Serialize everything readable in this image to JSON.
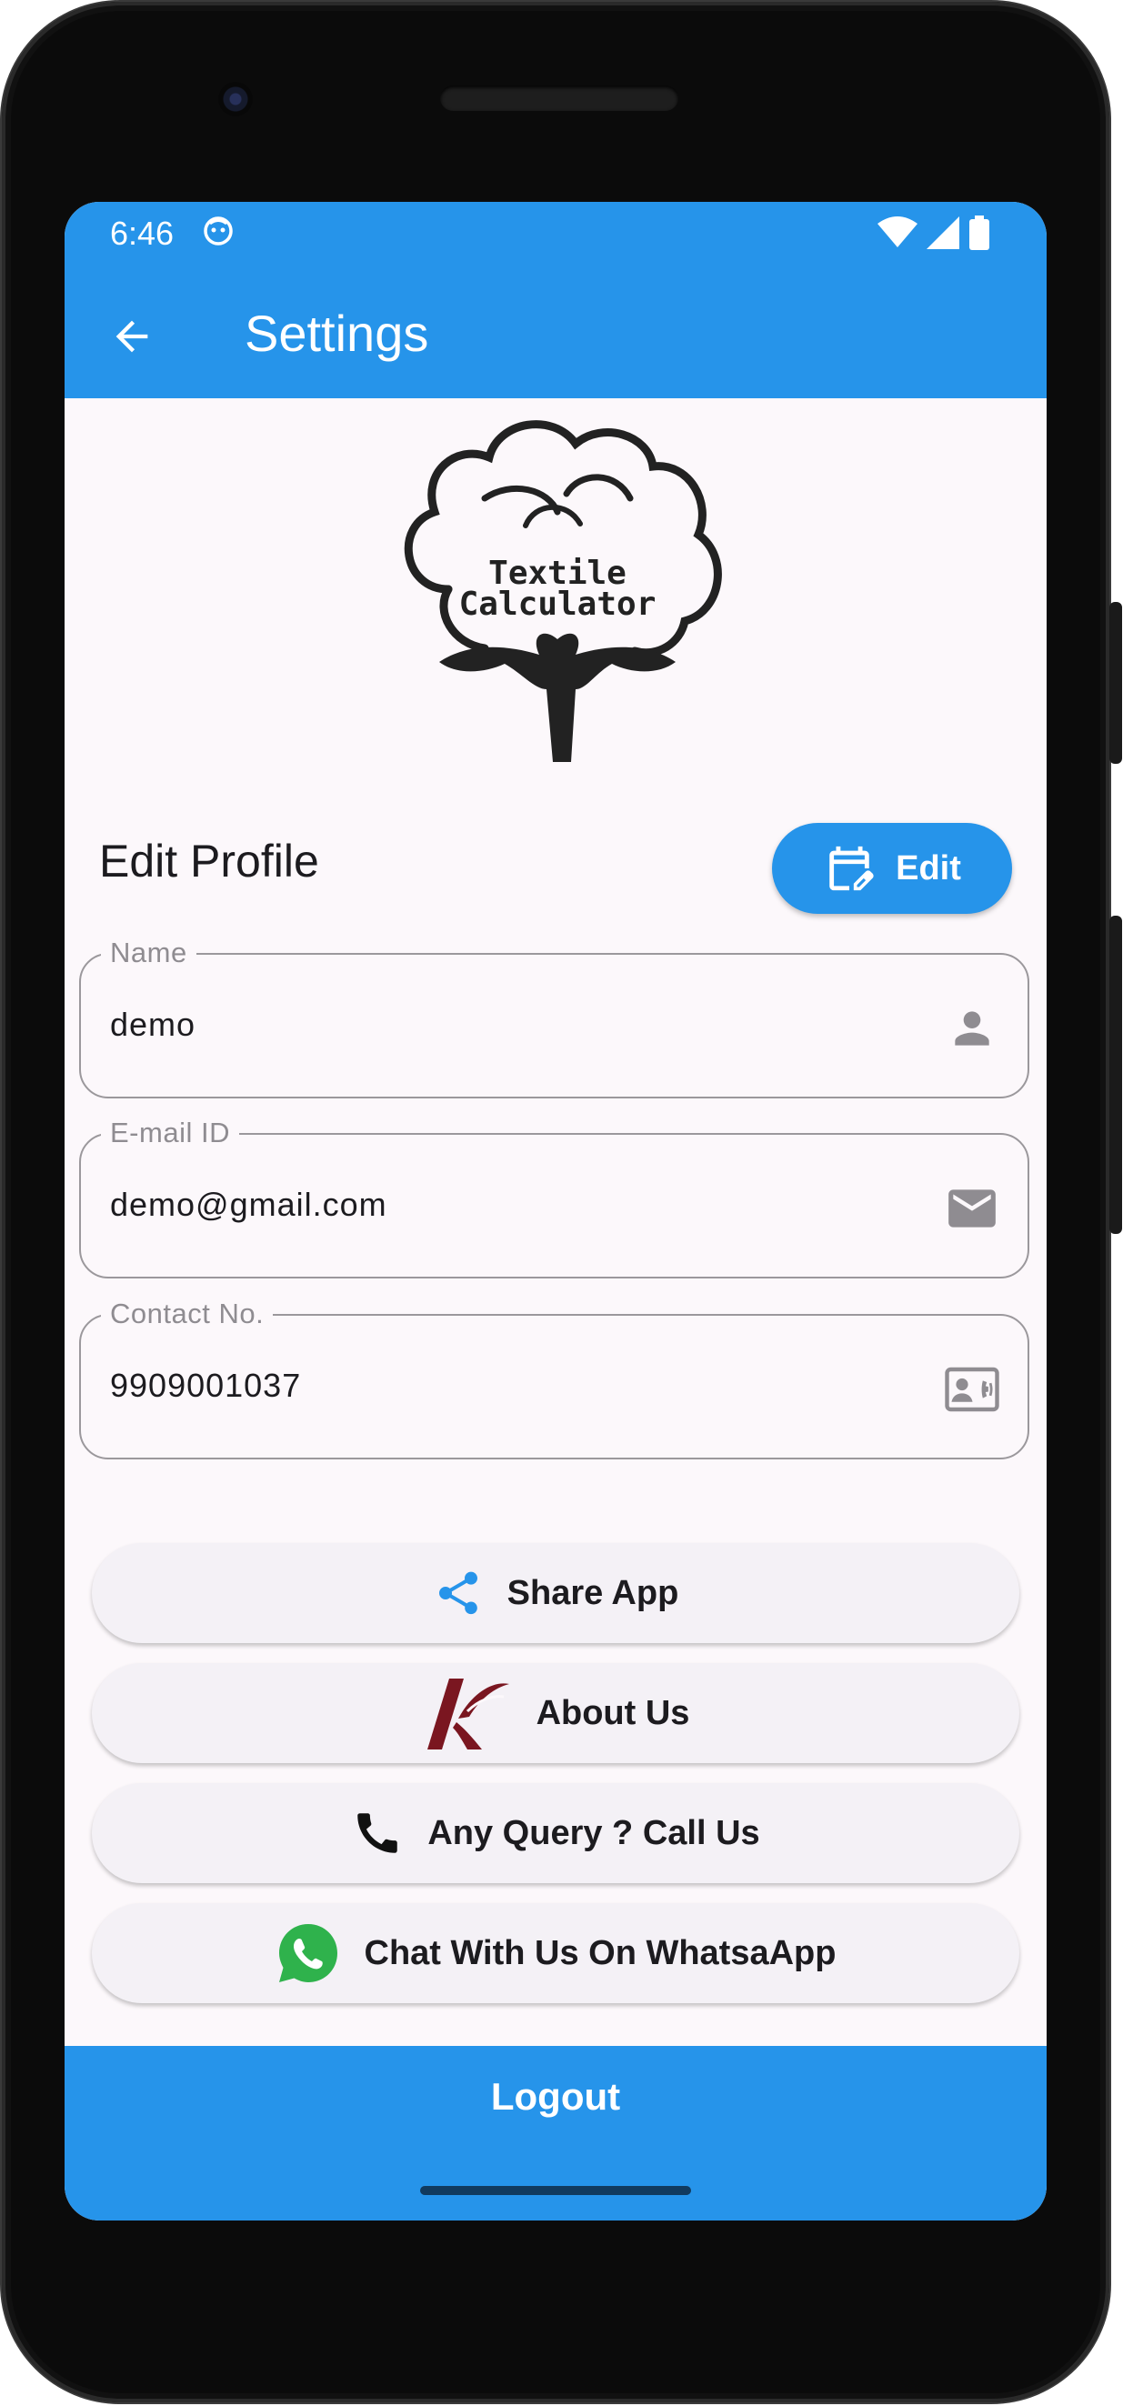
{
  "status_bar": {
    "time": "6:46"
  },
  "app_bar": {
    "title": "Settings"
  },
  "logo": {
    "line1": "Textile",
    "line2": "Calculator"
  },
  "profile": {
    "section_title": "Edit Profile",
    "edit_label": "Edit",
    "fields": [
      {
        "label": "Name",
        "value": "demo",
        "icon": "person-icon"
      },
      {
        "label": "E-mail ID",
        "value": "demo@gmail.com",
        "icon": "mail-icon"
      },
      {
        "label": "Contact No.",
        "value": "9909001037",
        "icon": "contact-card-icon"
      }
    ]
  },
  "actions": [
    {
      "label": "Share App",
      "icon": "share-icon"
    },
    {
      "label": "About Us",
      "icon": "k-brand-logo-icon"
    },
    {
      "label": "Any Query ? Call Us",
      "icon": "phone-icon"
    },
    {
      "label": "Chat With Us On WhatsaApp",
      "icon": "whatsapp-icon"
    }
  ],
  "logout": {
    "label": "Logout"
  },
  "colors": {
    "primary": "#2694ea",
    "surface": "#fcf8fb",
    "button_surface": "#f4f1f6",
    "brand_k": "#7a1620"
  }
}
